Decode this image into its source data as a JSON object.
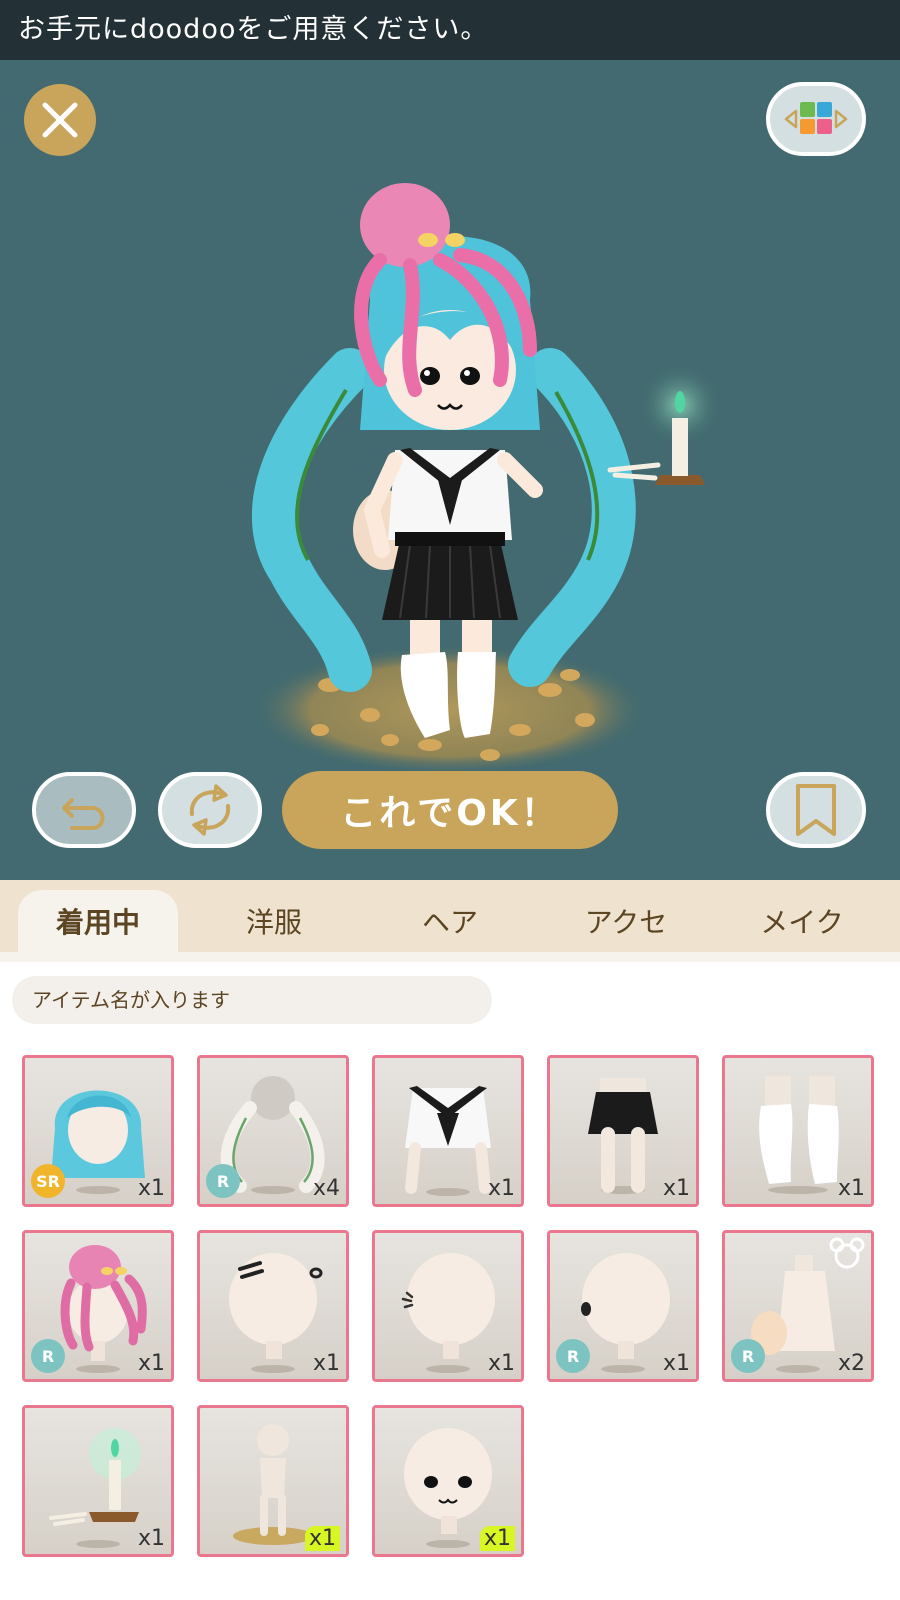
{
  "banner": {
    "text": "お手元にdoodooをご用意ください。"
  },
  "stage": {
    "close_icon": "close-icon",
    "palette_icon": "color-palette-icon",
    "undo_icon": "undo-icon",
    "reset_icon": "refresh-icon",
    "bookmark_icon": "bookmark-icon",
    "ok_label": "これでOK！"
  },
  "tabs": [
    {
      "label": "着用中",
      "active": true
    },
    {
      "label": "洋服",
      "active": false
    },
    {
      "label": "ヘア",
      "active": false
    },
    {
      "label": "アクセ",
      "active": false
    },
    {
      "label": "メイク",
      "active": false
    }
  ],
  "item_name": {
    "placeholder": "アイテム名が入ります"
  },
  "items": [
    {
      "name": "blue-wavy-hair",
      "rarity": "SR",
      "qty": "x1"
    },
    {
      "name": "braided-vine-hair",
      "rarity": "R",
      "qty": "x4"
    },
    {
      "name": "sailor-top",
      "rarity": "",
      "qty": "x1"
    },
    {
      "name": "black-pleated-skirt",
      "rarity": "",
      "qty": "x1"
    },
    {
      "name": "loose-socks",
      "rarity": "",
      "qty": "x1"
    },
    {
      "name": "octopus-hat",
      "rarity": "R",
      "qty": "x1"
    },
    {
      "name": "hair-clips",
      "rarity": "",
      "qty": "x1"
    },
    {
      "name": "ear-sparkle",
      "rarity": "",
      "qty": "x1"
    },
    {
      "name": "ear-piercing",
      "rarity": "R",
      "qty": "x1"
    },
    {
      "name": "fluffy-tail",
      "rarity": "R",
      "qty": "x2",
      "badge": "bear-icon"
    },
    {
      "name": "candle-holder",
      "rarity": "",
      "qty": "x1"
    },
    {
      "name": "body-stand",
      "rarity": "",
      "qty": "x1",
      "highlight": true
    },
    {
      "name": "face-makeup",
      "rarity": "",
      "qty": "x1",
      "highlight": true
    }
  ],
  "colors": {
    "banner_bg": "#233136",
    "stage_bg": "#426a70",
    "gold": "#c8a55a",
    "tab_bg": "#efe3d0",
    "item_border": "#e9788f",
    "new_highlight": "#d8f524"
  }
}
